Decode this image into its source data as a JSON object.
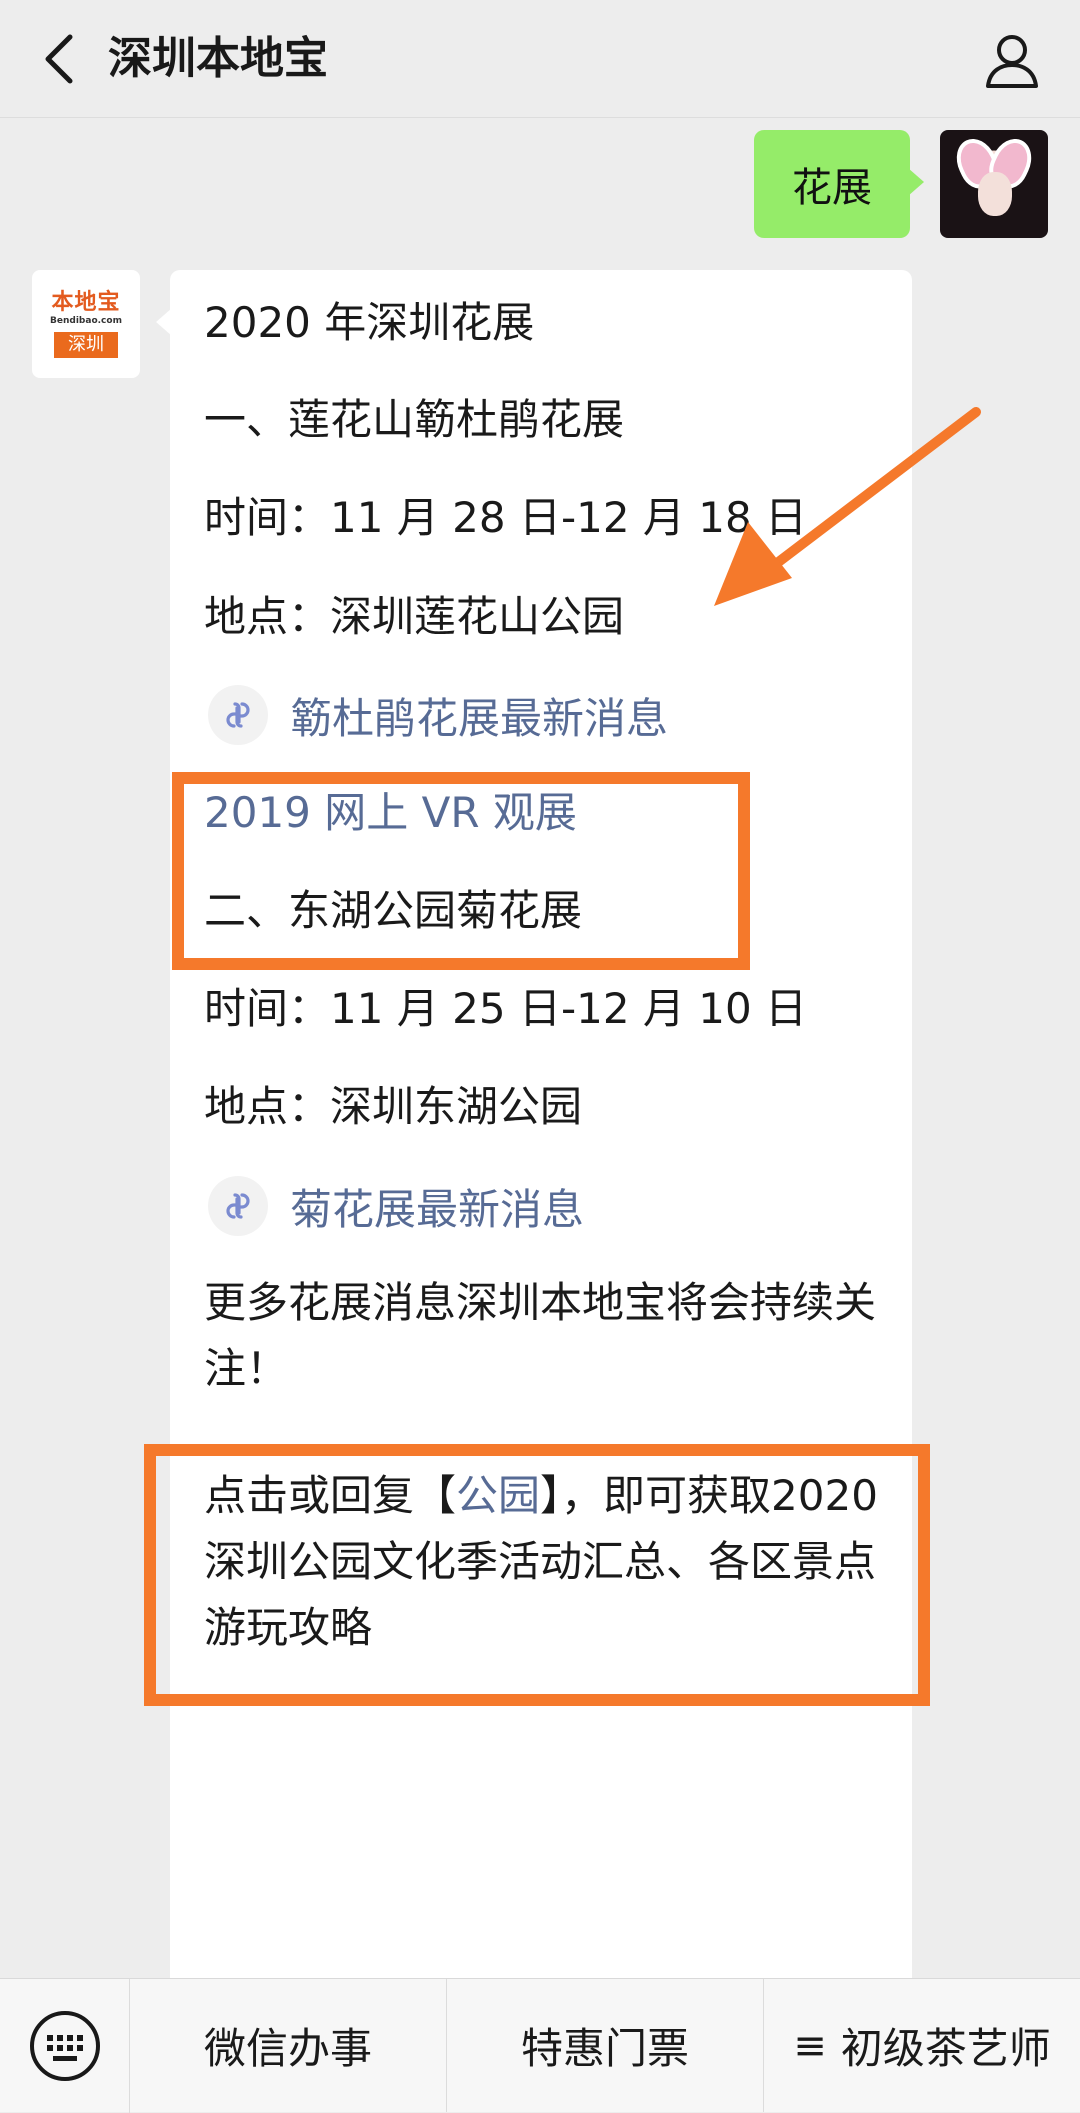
{
  "header": {
    "title": "深圳本地宝"
  },
  "outgoing": {
    "text": "花展"
  },
  "bot": {
    "logo_main": "本地宝",
    "logo_url": "Bendibao.com",
    "logo_city": "深圳"
  },
  "message": {
    "l1": "2020 年深圳花展",
    "l2": "一、莲花山簕杜鹃花展",
    "l3": "时间：11 月 28 日-12 月 18 日",
    "l4": "地点：深圳莲花山公园",
    "link1": "簕杜鹃花展最新消息",
    "link2": "2019 网上 VR 观展",
    "l5": "二、东湖公园菊花展",
    "l6": "时间：11 月 25 日-12 月 10 日",
    "l7": "地点：深圳东湖公园",
    "link3": "菊花展最新消息",
    "l8": "更多花展消息深圳本地宝将会持续关注！",
    "l9_pre": "点击或回复【",
    "l9_kw": "公园",
    "l9_post": "】，即可获取2020 深圳公园文化季活动汇总、各区景点游玩攻略"
  },
  "menu": {
    "item1": "微信办事",
    "item2": "特惠门票",
    "item3_icon": "≡",
    "item3": "初级茶艺师"
  },
  "colors": {
    "bubble_out": "#95ec69",
    "link": "#576b95",
    "highlight": "#f5792b"
  }
}
